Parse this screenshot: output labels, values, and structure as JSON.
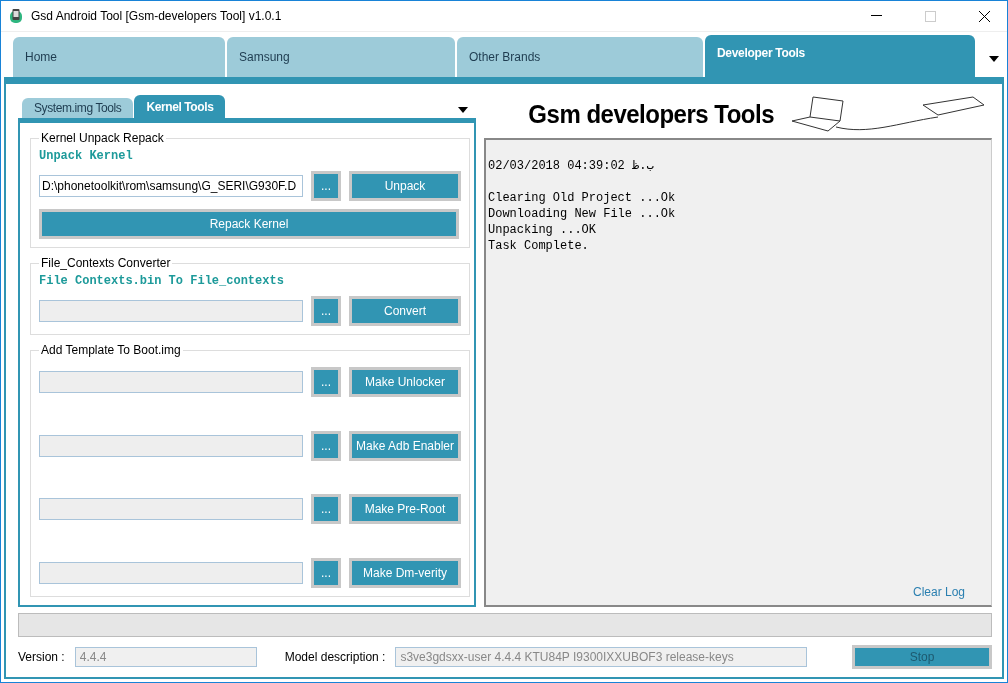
{
  "window": {
    "title": "Gsd Android Tool [Gsm-developers Tool] v1.0.1"
  },
  "tabs": [
    {
      "label": "Home",
      "selected": false
    },
    {
      "label": "Samsung",
      "selected": false
    },
    {
      "label": "Other Brands",
      "selected": false
    },
    {
      "label": "Developer Tools",
      "selected": true
    }
  ],
  "sub_tabs": [
    {
      "label": "System.img Tools",
      "selected": false
    },
    {
      "label": "Kernel Tools",
      "selected": true
    }
  ],
  "groups": [
    {
      "title": "Kernel Unpack  Repack",
      "caption": "Unpack Kernel",
      "rows": [
        {
          "path": "D:\\phonetoolkit\\rom\\samsung\\G_SERI\\G930F.D",
          "browse": "...",
          "action": "Unpack"
        }
      ],
      "wide_button": "Repack Kernel"
    },
    {
      "title": "File_Contexts Converter",
      "caption": "File Contexts.bin To File_contexts",
      "rows": [
        {
          "path": "",
          "browse": "...",
          "action": "Convert"
        }
      ]
    },
    {
      "title": "Add Template To Boot.img",
      "rows": [
        {
          "path": "",
          "browse": "...",
          "action": "Make Unlocker"
        },
        {
          "path": "",
          "browse": "...",
          "action": "Make Adb Enabler"
        },
        {
          "path": "",
          "browse": "...",
          "action": "Make Pre-Root"
        },
        {
          "path": "",
          "browse": "...",
          "action": "Make Dm-verity"
        }
      ]
    }
  ],
  "banner": {
    "title": "Gsm developers Tools"
  },
  "log": {
    "timestamp": "02/03/2018 04:39:02 ب.ظ",
    "lines": [
      "Clearing Old Project ...Ok",
      "Downloading New File ...Ok",
      "Unpacking ...OK",
      "Task Complete."
    ],
    "clear_link": "Clear Log"
  },
  "progress": {
    "level": 0
  },
  "footer": {
    "version_label": "Version :",
    "version": "4.4.4",
    "model_label": "Model description :",
    "model": "s3ve3gdsxx-user 4.4.4 KTU84P I9300IXXUBOF3 release-keys",
    "stop": {
      "label": "Stop",
      "disabled": true
    }
  }
}
